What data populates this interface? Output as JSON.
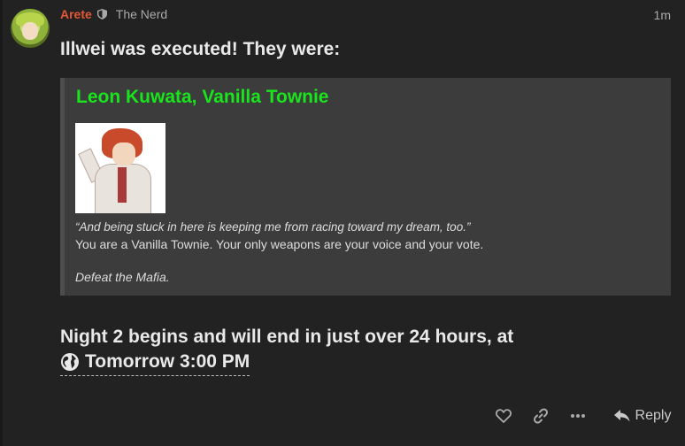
{
  "post": {
    "username": "Arete",
    "user_title": "The Nerd",
    "timestamp": "1m",
    "headline": "Illwei was executed! They were:"
  },
  "role_card": {
    "name": "Leon Kuwata, Vanilla Townie",
    "quote": "“And being stuck in here is keeping me from racing toward my dream, too.”",
    "description": "You are a Vanilla Townie. Your only weapons are your voice and your vote.",
    "goal": "Defeat the Mafia.",
    "name_color": "#18e51c"
  },
  "night": {
    "line1": "Night 2 begins and will end in just over 24 hours, at",
    "time": "Tomorrow 3:00 PM"
  },
  "actions": {
    "reply_label": "Reply"
  },
  "icons": [
    "shield-icon",
    "globe-icon",
    "heart-icon",
    "link-icon",
    "ellipsis-icon",
    "reply-icon"
  ],
  "colors": {
    "username": "#e45735",
    "background": "#222222",
    "quote_bg": "#3c3c3c"
  }
}
